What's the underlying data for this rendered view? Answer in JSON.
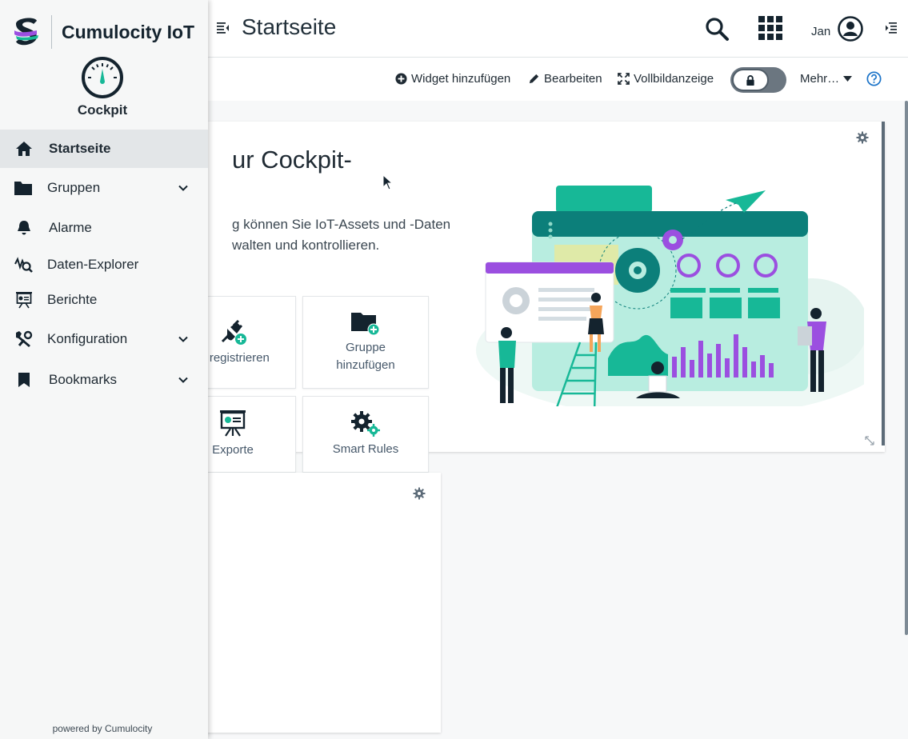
{
  "header": {
    "title": "Startseite",
    "user": "Jan"
  },
  "actions": {
    "add_widget": "Widget hinzufügen",
    "edit": "Bearbeiten",
    "fullscreen": "Vollbildanzeige",
    "more": "Mehr…"
  },
  "sidebar": {
    "brand": "Cumulocity IoT",
    "app_name": "Cockpit",
    "items": [
      {
        "label": "Startseite",
        "icon": "home-icon",
        "active": true
      },
      {
        "label": "Gruppen",
        "icon": "folder-icon",
        "expandable": true
      },
      {
        "label": "Alarme",
        "icon": "bell-icon"
      },
      {
        "label": "Daten-Explorer",
        "icon": "data-explorer-icon"
      },
      {
        "label": "Berichte",
        "icon": "report-icon"
      },
      {
        "label": "Konfiguration",
        "icon": "wrench-icon",
        "expandable": true
      },
      {
        "label": "Bookmarks",
        "icon": "bookmark-icon",
        "expandable": true
      }
    ],
    "powered_by": "powered by Cumulocity"
  },
  "welcome": {
    "title_fragment": "ur Cockpit-",
    "text_line1": "g können Sie IoT-Assets und -Daten",
    "text_line2": "walten und kontrollieren.",
    "quick_links": {
      "device": "ät registrieren",
      "group_line1": "Gruppe",
      "group_line2": "hinzufügen",
      "exports": "Exporte",
      "smart_rules": "Smart Rules"
    }
  },
  "second_widget": {
    "text_fragment": "."
  },
  "colors": {
    "teal": "#17b897",
    "teal_dark": "#0c7f7a",
    "purple": "#9b4fe0",
    "navy": "#14232e",
    "link_blue": "#1a73c8"
  }
}
